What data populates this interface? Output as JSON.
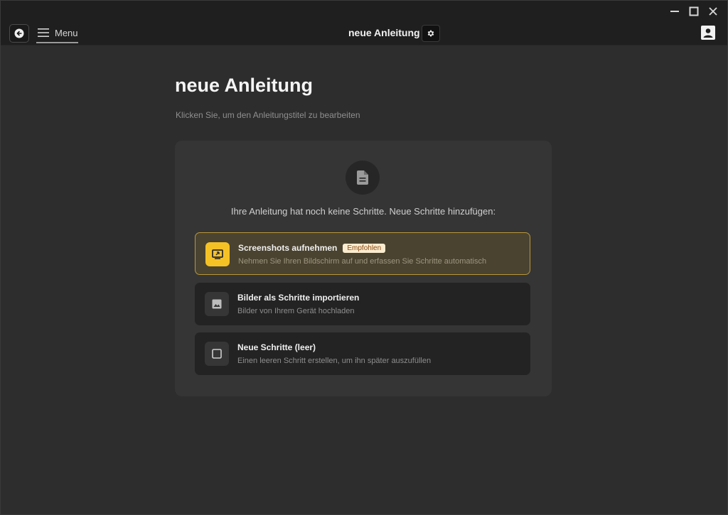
{
  "toolbar": {
    "menu_label": "Menu",
    "doc_title": "neue Anleitung"
  },
  "main": {
    "title": "neue Anleitung",
    "subtitle": "Klicken Sie, um den Anleitungstitel zu bearbeiten",
    "empty_text": "Ihre Anleitung hat noch keine Schritte. Neue Schritte hinzufügen:",
    "options": [
      {
        "title": "Screenshots aufnehmen",
        "badge": "Empfohlen",
        "description": "Nehmen Sie Ihren Bildschirm auf und erfassen Sie Schritte automatisch",
        "icon": "screen-capture-icon"
      },
      {
        "title": "Bilder als Schritte importieren",
        "description": "Bilder von Ihrem Gerät hochladen",
        "icon": "image-icon"
      },
      {
        "title": "Neue Schritte (leer)",
        "description": "Einen leeren Schritt erstellen, um ihn später auszufüllen",
        "icon": "empty-square-icon"
      }
    ]
  },
  "colors": {
    "accent": "#f5c226",
    "background": "#2d2d2d",
    "panel": "#353535"
  }
}
